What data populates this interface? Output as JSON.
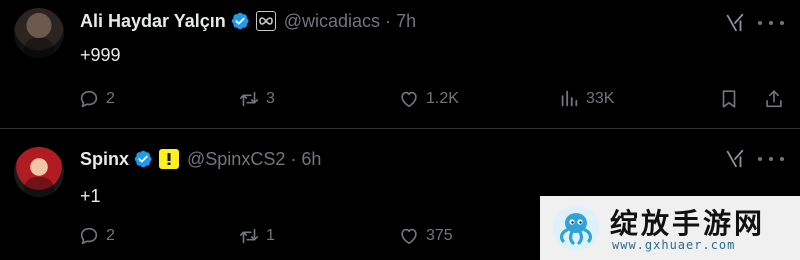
{
  "tweets": [
    {
      "name": "Ali Haydar Yalçın",
      "handle": "@wicadiacs",
      "time": "7h",
      "text": "+999",
      "replies": "2",
      "retweets": "3",
      "likes": "1.2K",
      "views": "33K",
      "affiliate_badge": "infinity-badge-icon"
    },
    {
      "name": "Spinx",
      "handle": "@SpinxCS2",
      "time": "6h",
      "text": "+1",
      "replies": "2",
      "retweets": "1",
      "likes": "375",
      "affiliate_badge": "exclamation-badge-icon"
    }
  ],
  "separator": "·",
  "colors": {
    "background": "#000000",
    "text": "#e7e9ea",
    "muted": "#71767b",
    "verified": "#1d9bf0",
    "divider": "#2f3336",
    "badge_yellow": "#fff11d"
  },
  "watermark": {
    "title": "绽放手游网",
    "url": "www.gxhuaer.com"
  }
}
